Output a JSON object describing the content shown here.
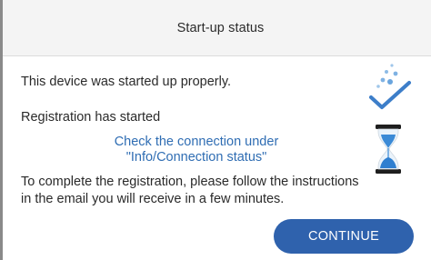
{
  "dialog": {
    "title": "Start-up status"
  },
  "status": {
    "device_ok": "This device was started up properly.",
    "registration": "Registration has started",
    "link_line1": "Check the connection under",
    "link_line2": "\"Info/Connection status\"",
    "instructions_line1": "To complete the registration, please follow the instructions",
    "instructions_line2": "in the email you will receive in a few minutes."
  },
  "icons": {
    "success": "checkmark-icon",
    "pending": "hourglass-icon"
  },
  "actions": {
    "continue_label": "CONTINUE"
  },
  "colors": {
    "accent": "#2f62ad",
    "link": "#2f6db3",
    "check": "#3d7ec9",
    "header_bg": "#f4f4f4"
  }
}
